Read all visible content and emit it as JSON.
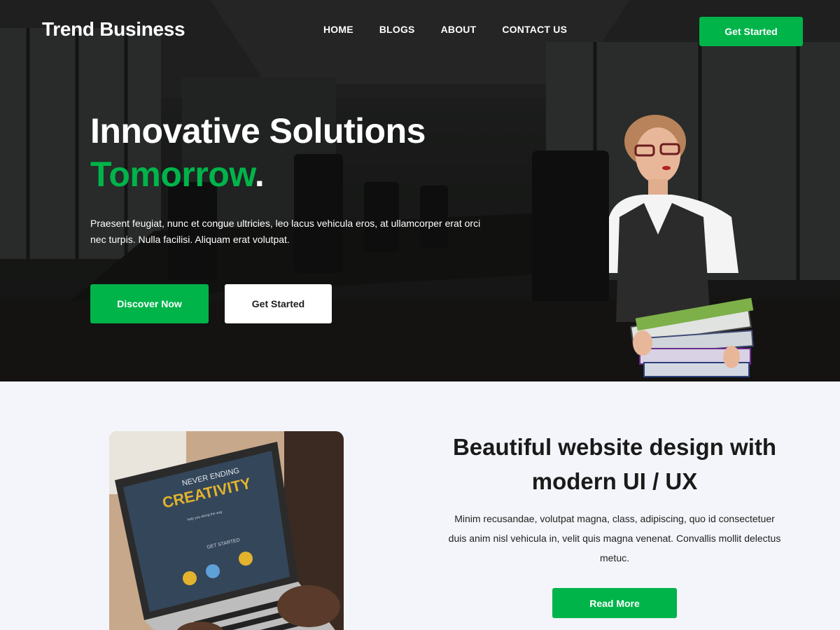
{
  "header": {
    "logo": "Trend Business",
    "nav": [
      "HOME",
      "BLOGS",
      "ABOUT",
      "CONTACT US"
    ],
    "cta_label": "Get Started"
  },
  "hero": {
    "title_line1": "Innovative Solutions",
    "title_accent": "Tomorrow",
    "title_dot": ".",
    "description": "Praesent feugiat, nunc et congue ultricies, leo lacus vehicula eros, at ullamcorper erat orci nec turpis. Nulla facilisi. Aliquam erat volutpat.",
    "primary_button": "Discover Now",
    "secondary_button": "Get Started"
  },
  "feature": {
    "laptop_screen": {
      "line1": "NEVER ENDING",
      "line2": "CREATIVITY",
      "line3": "help you along the way",
      "line4": "GET STARTED"
    },
    "title": "Beautiful website design with modern UI / UX",
    "description": "Minim recusandae, volutpat magna, class, adipiscing, quo id consectetuer duis anim nisl vehicula in, velit quis magna venenat. Convallis mollit delectus metuc.",
    "button": "Read More"
  },
  "colors": {
    "accent": "#00b44a",
    "hero_bg": "#1f211f",
    "section_bg": "#f4f5fa"
  }
}
